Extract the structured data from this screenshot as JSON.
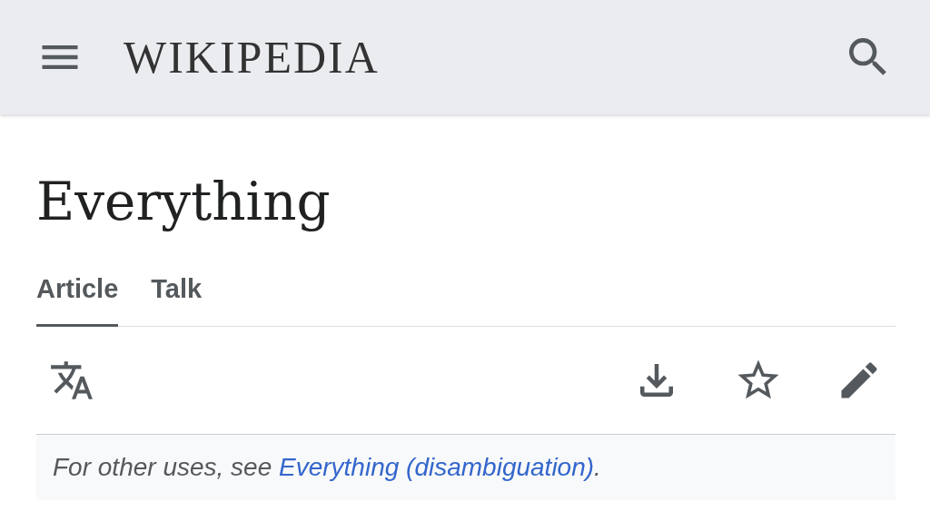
{
  "header": {
    "wordmark": "WIKIPEDIA"
  },
  "page": {
    "title": "Everything"
  },
  "tabs": [
    {
      "label": "Article",
      "selected": true
    },
    {
      "label": "Talk",
      "selected": false
    }
  ],
  "hatnote": {
    "text": "For other uses, see ",
    "link": "Everything (disambiguation)",
    "end": "."
  }
}
